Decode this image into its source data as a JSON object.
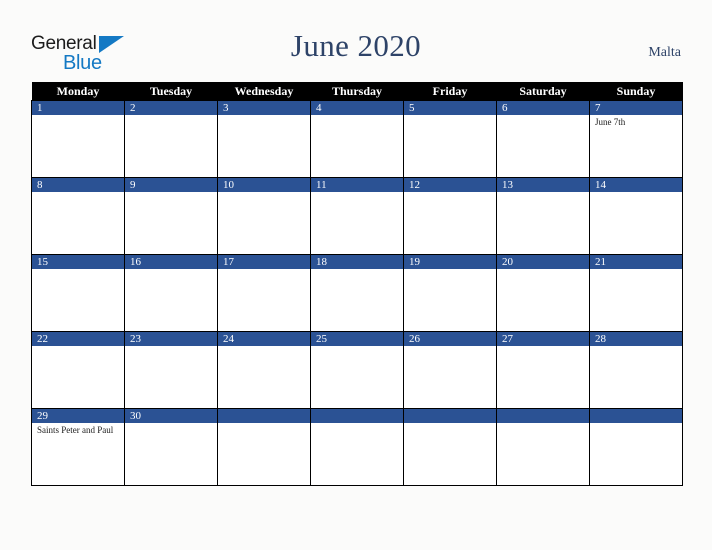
{
  "brand": {
    "name_part1": "General",
    "name_part2": "Blue",
    "triangle_icon": "triangle-icon",
    "primary_color": "#1479c4",
    "text_color": "#1c1c1c"
  },
  "header": {
    "title": "June 2020",
    "locale": "Malta",
    "title_color": "#2e4368"
  },
  "calendar": {
    "weekday_headers": [
      "Monday",
      "Tuesday",
      "Wednesday",
      "Thursday",
      "Friday",
      "Saturday",
      "Sunday"
    ],
    "header_bg": "#000000",
    "header_fg": "#ffffff",
    "daynum_bg": "#2b5294",
    "daynum_fg": "#ffffff",
    "cell_bg": "#ffffff",
    "border_color": "#000000",
    "weeks": [
      [
        {
          "day": "1",
          "events": []
        },
        {
          "day": "2",
          "events": []
        },
        {
          "day": "3",
          "events": []
        },
        {
          "day": "4",
          "events": []
        },
        {
          "day": "5",
          "events": []
        },
        {
          "day": "6",
          "events": []
        },
        {
          "day": "7",
          "events": [
            "June 7th"
          ]
        }
      ],
      [
        {
          "day": "8",
          "events": []
        },
        {
          "day": "9",
          "events": []
        },
        {
          "day": "10",
          "events": []
        },
        {
          "day": "11",
          "events": []
        },
        {
          "day": "12",
          "events": []
        },
        {
          "day": "13",
          "events": []
        },
        {
          "day": "14",
          "events": []
        }
      ],
      [
        {
          "day": "15",
          "events": []
        },
        {
          "day": "16",
          "events": []
        },
        {
          "day": "17",
          "events": []
        },
        {
          "day": "18",
          "events": []
        },
        {
          "day": "19",
          "events": []
        },
        {
          "day": "20",
          "events": []
        },
        {
          "day": "21",
          "events": []
        }
      ],
      [
        {
          "day": "22",
          "events": []
        },
        {
          "day": "23",
          "events": []
        },
        {
          "day": "24",
          "events": []
        },
        {
          "day": "25",
          "events": []
        },
        {
          "day": "26",
          "events": []
        },
        {
          "day": "27",
          "events": []
        },
        {
          "day": "28",
          "events": []
        }
      ],
      [
        {
          "day": "29",
          "events": [
            "Saints Peter and Paul"
          ]
        },
        {
          "day": "30",
          "events": []
        },
        {
          "day": "",
          "events": []
        },
        {
          "day": "",
          "events": []
        },
        {
          "day": "",
          "events": []
        },
        {
          "day": "",
          "events": []
        },
        {
          "day": "",
          "events": []
        }
      ]
    ]
  }
}
